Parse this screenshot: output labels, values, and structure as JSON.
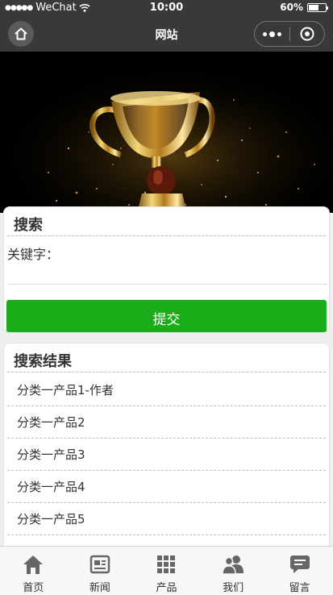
{
  "status_bar": {
    "carrier": "WeChat",
    "time": "10:00",
    "battery": "60%",
    "battery_level": 0.6
  },
  "nav": {
    "title": "网站"
  },
  "search": {
    "title": "搜索",
    "keyword_label": "关键字：",
    "keyword_value": "",
    "submit_label": "提交"
  },
  "results": {
    "title": "搜索结果",
    "items": [
      "分类一产品1-作者",
      "分类一产品2",
      "分类一产品3",
      "分类一产品4",
      "分类一产品5"
    ]
  },
  "tabbar": {
    "items": [
      {
        "label": "首页",
        "icon": "home-icon"
      },
      {
        "label": "新闻",
        "icon": "news-icon"
      },
      {
        "label": "产品",
        "icon": "grid-icon"
      },
      {
        "label": "我们",
        "icon": "people-icon"
      },
      {
        "label": "留言",
        "icon": "message-icon"
      }
    ]
  },
  "colors": {
    "primary_button": "#1aad19",
    "navbar": "#393939"
  }
}
